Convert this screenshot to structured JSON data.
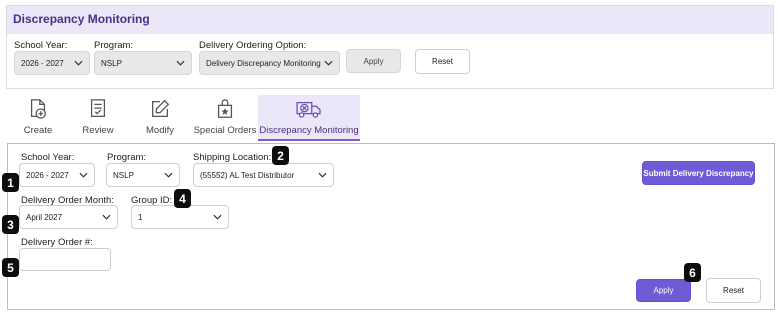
{
  "header": {
    "title": "Discrepancy Monitoring",
    "school_year_label": "School Year:",
    "school_year_value": "2026 - 2027",
    "program_label": "Program:",
    "program_value": "NSLP",
    "delivery_option_label": "Delivery Ordering Option:",
    "delivery_option_value": "Delivery Discrepancy Monitoring",
    "apply_label": "Apply",
    "reset_label": "Reset"
  },
  "tabs": [
    {
      "label": "Create",
      "icon": "file-plus-icon"
    },
    {
      "label": "Review",
      "icon": "checklist-icon"
    },
    {
      "label": "Modify",
      "icon": "edit-icon"
    },
    {
      "label": "Special Orders",
      "icon": "star-bag-icon"
    },
    {
      "label": "Discrepancy Monitoring",
      "icon": "truck-x-icon"
    }
  ],
  "form": {
    "school_year_label": "School Year:",
    "school_year_value": "2026 - 2027",
    "program_label": "Program:",
    "program_value": "NSLP",
    "shipping_location_label": "Shipping Location:",
    "shipping_location_value": "(55552) AL Test Distributor",
    "submit_label": "Submit Delivery Discrepancy",
    "delivery_month_label": "Delivery Order Month:",
    "delivery_month_value": "April 2027",
    "group_id_label": "Group ID:",
    "group_id_value": "1",
    "delivery_order_label": "Delivery Order #:",
    "delivery_order_value": "",
    "apply_label": "Apply",
    "reset_label": "Reset"
  },
  "badges": [
    "1",
    "2",
    "3",
    "4",
    "5",
    "6"
  ],
  "colors": {
    "accent": "#6f5bd6",
    "title_bar": "#ece7f8",
    "title_text": "#4a2f86",
    "badge": "#0d0d0d"
  }
}
